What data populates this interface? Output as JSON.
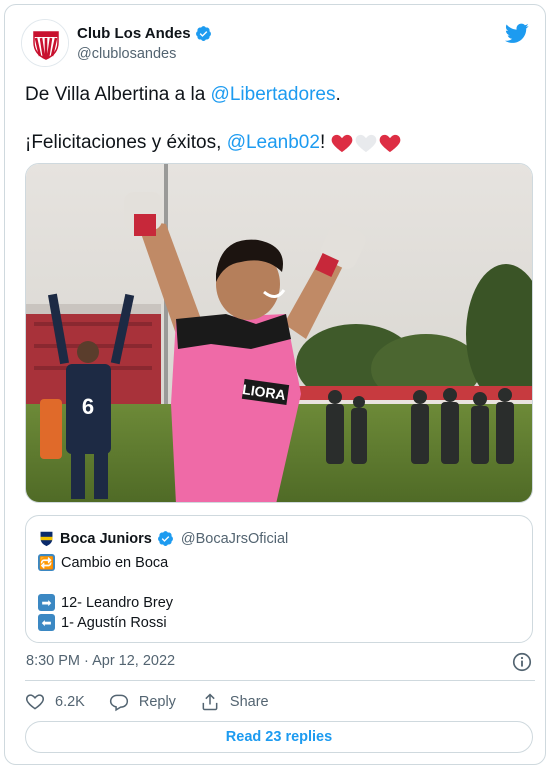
{
  "author": {
    "display_name": "Club Los Andes",
    "handle": "@clublosandes"
  },
  "tweet": {
    "line1_prefix": "De Villa Albertina a la ",
    "line1_mention": "@Libertadores",
    "line1_suffix": ".",
    "line2_prefix": "¡Felicitaciones y éxitos, ",
    "line2_mention": "@Leanb02",
    "line2_suffix": "!"
  },
  "jersey": {
    "number": "6",
    "sponsor": "LIORA"
  },
  "quote": {
    "display_name": "Boca Juniors",
    "handle": "@BocaJrsOficial",
    "line1": "Cambio en Boca",
    "line2": "12- Leandro Brey",
    "line3": "1- Agustín Rossi"
  },
  "meta": {
    "timestamp": "8:30 PM · Apr 12, 2022"
  },
  "actions": {
    "likes": "6.2K",
    "reply": "Reply",
    "share": "Share"
  },
  "read_replies": "Read 23 replies",
  "colors": {
    "accent": "#1d9bf0",
    "heart_red": "#dd2e44",
    "secondary_text": "#536471",
    "border": "#cfd9de"
  }
}
